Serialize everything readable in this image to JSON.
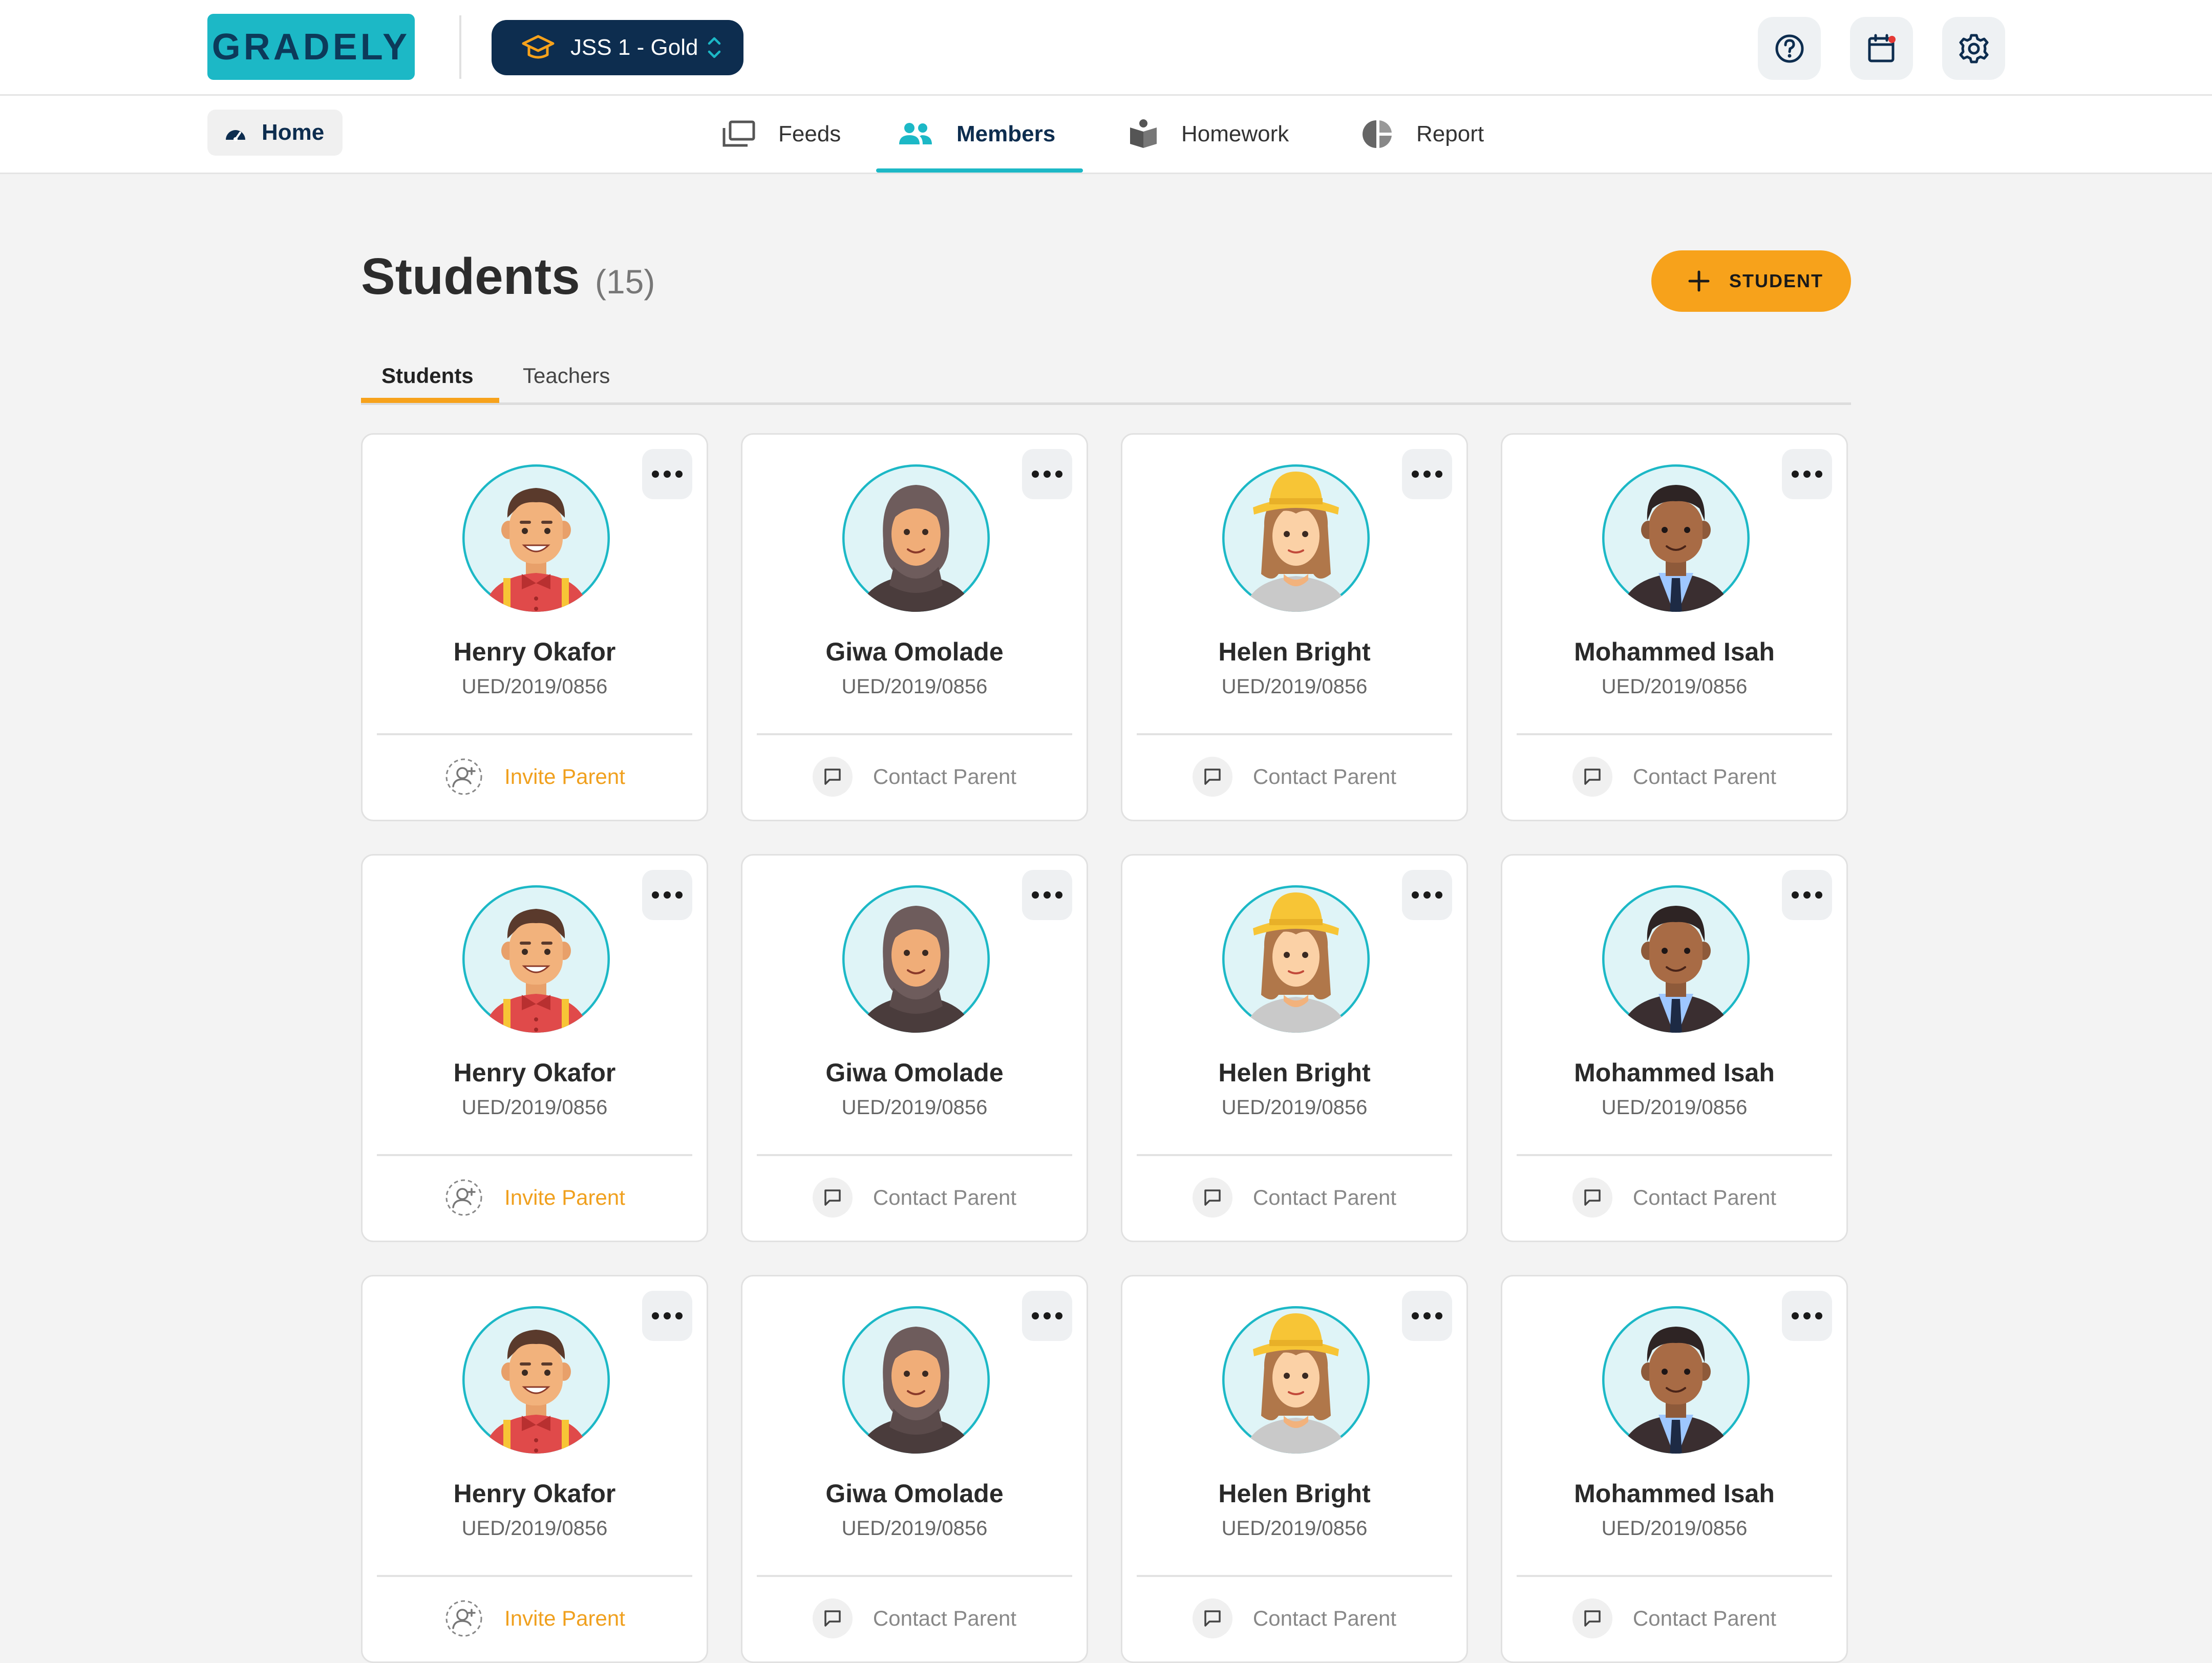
{
  "brand": {
    "logo_text": "GRADELY"
  },
  "header": {
    "class_selector": {
      "value": "JSS 1 - Gold"
    },
    "icons": [
      "help-icon",
      "calendar-icon",
      "settings-icon"
    ]
  },
  "nav": {
    "home_label": "Home",
    "tabs": [
      {
        "label": "Feeds",
        "icon": "feeds-icon"
      },
      {
        "label": "Members",
        "icon": "members-icon",
        "active": true
      },
      {
        "label": "Homework",
        "icon": "homework-icon"
      },
      {
        "label": "Report",
        "icon": "report-icon"
      }
    ]
  },
  "page": {
    "title": "Students",
    "count": "(15)",
    "add_button": "STUDENT",
    "tabs": [
      {
        "label": "Students",
        "active": true
      },
      {
        "label": "Teachers"
      }
    ]
  },
  "colors": {
    "brand": "#1cb8c6",
    "navy": "#0d2d4f",
    "accent": "#f7a21b"
  },
  "students": [
    {
      "name": "Henry Okafor",
      "id": "UED/2019/0856",
      "action": "Invite Parent",
      "avatar": "boy"
    },
    {
      "name": "Giwa Omolade",
      "id": "UED/2019/0856",
      "action": "Contact Parent",
      "avatar": "hijab"
    },
    {
      "name": "Helen Bright",
      "id": "UED/2019/0856",
      "action": "Contact Parent",
      "avatar": "girl"
    },
    {
      "name": "Mohammed Isah",
      "id": "UED/2019/0856",
      "action": "Contact Parent",
      "avatar": "tie"
    },
    {
      "name": "Henry Okafor",
      "id": "UED/2019/0856",
      "action": "Invite Parent",
      "avatar": "boy"
    },
    {
      "name": "Giwa Omolade",
      "id": "UED/2019/0856",
      "action": "Contact Parent",
      "avatar": "hijab"
    },
    {
      "name": "Helen Bright",
      "id": "UED/2019/0856",
      "action": "Contact Parent",
      "avatar": "girl"
    },
    {
      "name": "Mohammed Isah",
      "id": "UED/2019/0856",
      "action": "Contact Parent",
      "avatar": "tie"
    },
    {
      "name": "Henry Okafor",
      "id": "UED/2019/0856",
      "action": "Invite Parent",
      "avatar": "boy"
    },
    {
      "name": "Giwa Omolade",
      "id": "UED/2019/0856",
      "action": "Contact Parent",
      "avatar": "hijab"
    },
    {
      "name": "Helen Bright",
      "id": "UED/2019/0856",
      "action": "Contact Parent",
      "avatar": "girl"
    },
    {
      "name": "Mohammed Isah",
      "id": "UED/2019/0856",
      "action": "Contact Parent",
      "avatar": "tie"
    }
  ]
}
